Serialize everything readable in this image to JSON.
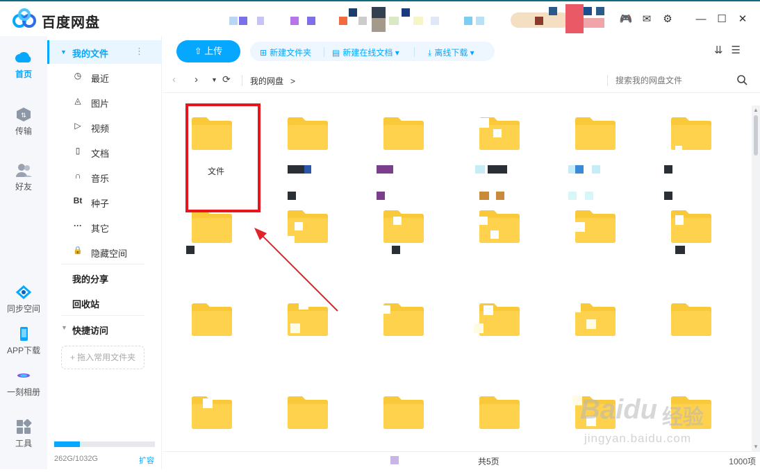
{
  "app": {
    "title": "百度网盘"
  },
  "colors": {
    "accent": "#06a7ff",
    "folder": "#ffd24d",
    "annotation": "#e8161c"
  },
  "window_controls": [
    {
      "name": "game-center-icon"
    },
    {
      "name": "mail-icon"
    },
    {
      "name": "settings-icon"
    },
    {
      "name": "minimize-icon"
    },
    {
      "name": "maximize-icon"
    },
    {
      "name": "close-icon"
    }
  ],
  "left_nav": {
    "home": "首页",
    "transfer": "传输",
    "friends": "好友",
    "sync": "同步空间",
    "app_download": "APP下载",
    "album": "一刻相册",
    "tools": "工具"
  },
  "sidebar": {
    "my_files": "我的文件",
    "more_glyph": "⋮",
    "items": [
      {
        "label": "最近",
        "icon": "clock-icon",
        "glyph": "◷"
      },
      {
        "label": "图片",
        "icon": "image-icon",
        "glyph": "◬"
      },
      {
        "label": "视频",
        "icon": "video-icon",
        "glyph": "▷"
      },
      {
        "label": "文档",
        "icon": "document-icon",
        "glyph": "▯"
      },
      {
        "label": "音乐",
        "icon": "headphones-icon",
        "glyph": "∩"
      },
      {
        "label": "种子",
        "icon": "torrent-icon",
        "glyph": "Bt"
      },
      {
        "label": "其它",
        "icon": "more-icon",
        "glyph": "···"
      },
      {
        "label": "隐藏空间",
        "icon": "lock-icon",
        "glyph": "🔒"
      }
    ],
    "my_share": "我的分享",
    "recycle_bin": "回收站",
    "quick_access": "快捷访问",
    "drop_hint": "+ 拖入常用文件夹",
    "storage_text": "262G/1032G",
    "storage_used_fraction": 0.254,
    "expand": "扩容"
  },
  "toolbar": {
    "upload": "上传",
    "new_folder": "新建文件夹",
    "new_online_doc": "新建在线文档",
    "offline_download": "离线下载"
  },
  "pathbar": {
    "crumb": "我的网盘",
    "crumb_sep": ">",
    "search_placeholder": "搜索我的网盘文件"
  },
  "files": {
    "first_folder_name": "文件"
  },
  "status": {
    "pages": "共5页",
    "count": "1000项"
  },
  "watermark": {
    "brand": "Baidu",
    "cn": "经验",
    "url": "jingyan.baidu.com"
  }
}
